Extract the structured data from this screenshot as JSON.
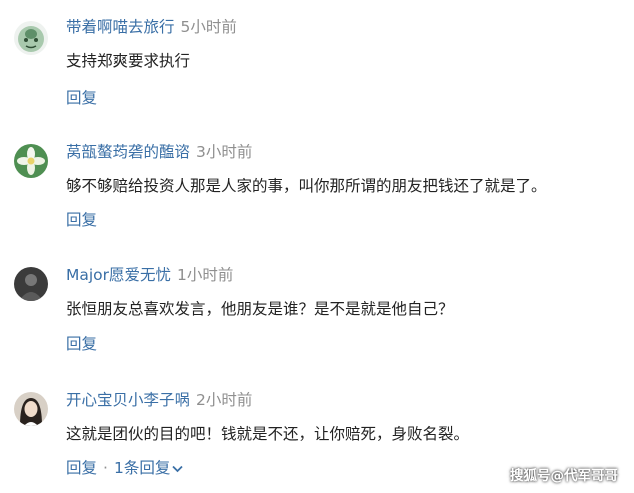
{
  "comments": [
    {
      "username": "带着啊喵去旅行",
      "time": "5小时前",
      "text": "支持郑爽要求执行",
      "reply_label": "回复",
      "avatar": "green-cartoon-face-icon"
    },
    {
      "username": "莴瓿螯荺砻的醢谘",
      "time": "3小时前",
      "text": "够不够赔给投资人那是人家的事，叫你那所谓的朋友把钱还了就是了。",
      "reply_label": "回复",
      "avatar": "green-flower-icon"
    },
    {
      "username": "Major愿爱无忧",
      "time": "1小时前",
      "text": "张恒朋友总喜欢发言，他朋友是谁？是不是就是他自己？",
      "reply_label": "回复",
      "avatar": "dark-profile-photo"
    },
    {
      "username": "开心宝贝小李子㖞",
      "time": "2小时前",
      "text": "这就是团伙的目的吧！钱就是不还，让你赔死，身败名裂。",
      "reply_label": "回复",
      "replies_label": "1条回复",
      "avatar": "woman-portrait-photo"
    }
  ],
  "watermark": "搜狐号@代军哥哥",
  "colors": {
    "link": "#3a6fa6",
    "meta": "#8f8f8f",
    "text": "#222222"
  }
}
